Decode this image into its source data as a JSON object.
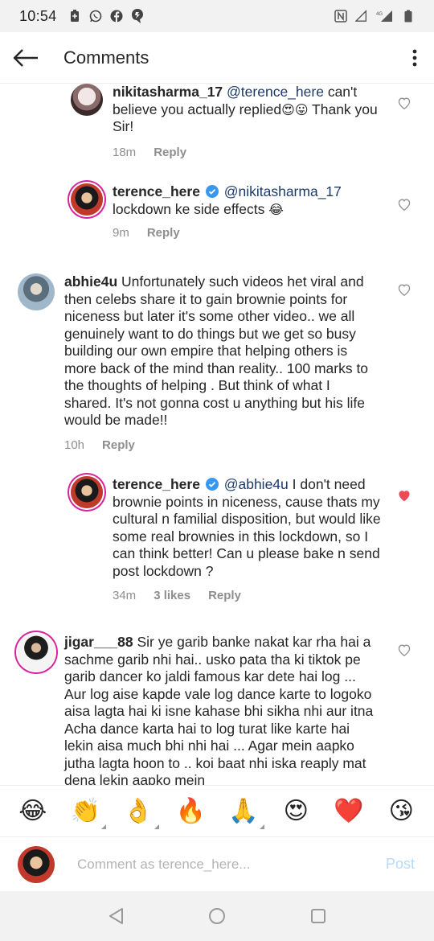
{
  "status_bar": {
    "time": "10:54",
    "network_label": "4G"
  },
  "header": {
    "title": "Comments"
  },
  "comments": [
    {
      "username": "nikitasharma_17",
      "mention": "@terence_here",
      "text": " can't believe you actually replied",
      "emoji": "😍😛",
      "text_after": " Thank you Sir!",
      "time": "18m",
      "reply_label": "Reply",
      "liked": false
    },
    {
      "username": "terence_here",
      "mention": "@nikitasharma_17",
      "text": "lockdown ke side effects ",
      "emoji": "😂",
      "time": "9m",
      "reply_label": "Reply",
      "liked": false
    },
    {
      "username": "abhie4u",
      "text": " Unfortunately such videos het viral and then celebs share it to gain brownie points for niceness but later it's some other video.. we all genuinely want to do things but we get so busy building our own empire that helping others is more back of the mind than reality.. 100 marks to the thoughts of helping . But think of what I shared. It's not gonna cost u anything but his life would be made!!",
      "time": "10h",
      "reply_label": "Reply",
      "liked": false
    },
    {
      "username": "terence_here",
      "mention": "@abhie4u",
      "text": " I don't need brownie points in niceness, cause thats my cultural n familial disposition, but would like some real brownies in this lockdown, so I can think better! Can u please bake n send post lockdown ?",
      "time": "34m",
      "likes": "3 likes",
      "reply_label": "Reply",
      "liked": true
    },
    {
      "username": "jigar___88",
      "text": " Sir ye garib banke nakat kar rha hai a sachme garib nhi hai.. usko pata tha ki tiktok pe garib dancer ko jaldi famous kar dete hai log ... Aur log aise kapde vale log dance karte to logoko aisa lagta hai ki isne kahase bhi sikha nhi aur itna Acha dance karta hai to log turat like karte hai lekin aisa much bhi nhi  hai ... Agar mein aapko jutha lagta hoon to .. koi baat nhi iska reaply mat dena lekin aapko mein",
      "liked": false
    }
  ],
  "emoji_bar": [
    "😂",
    "👏",
    "👌",
    "🔥",
    "🙏",
    "😍",
    "❤️",
    "😘"
  ],
  "composer": {
    "placeholder": "Comment as terence_here...",
    "post_label": "Post"
  },
  "colors": {
    "mention": "#1b3a6b",
    "verified": "#3897f0",
    "liked_heart": "#ed4956",
    "post_disabled": "#b3dbff"
  }
}
